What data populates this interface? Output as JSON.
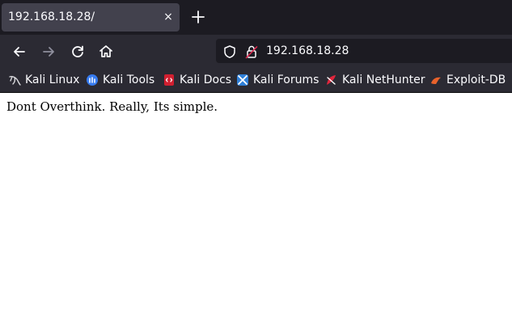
{
  "tab": {
    "title": "192.168.18.28/",
    "close_glyph": "×"
  },
  "navbar": {
    "url": "192.168.18.28",
    "icons": [
      "back-icon",
      "forward-icon",
      "reload-icon",
      "home-icon",
      "shield-icon",
      "lock-icon"
    ]
  },
  "bookmarks": {
    "items": [
      {
        "label": "Kali Linux",
        "icon": "kali-dragon-icon"
      },
      {
        "label": "Kali Tools",
        "icon": "kali-tools-icon"
      },
      {
        "label": "Kali Docs",
        "icon": "kali-docs-icon"
      },
      {
        "label": "Kali Forums",
        "icon": "kali-forums-icon"
      },
      {
        "label": "Kali NetHunter",
        "icon": "kali-nethunter-icon"
      },
      {
        "label": "Exploit-DB",
        "icon": "exploit-db-icon"
      }
    ]
  },
  "page": {
    "text": "Dont Overthink. Really, Its simple."
  },
  "colors": {
    "tabstrip_bg": "#1c1b22",
    "tab_bg": "#42414d",
    "toolbar_bg": "#2b2a33",
    "text_light": "#fbfbfe"
  }
}
